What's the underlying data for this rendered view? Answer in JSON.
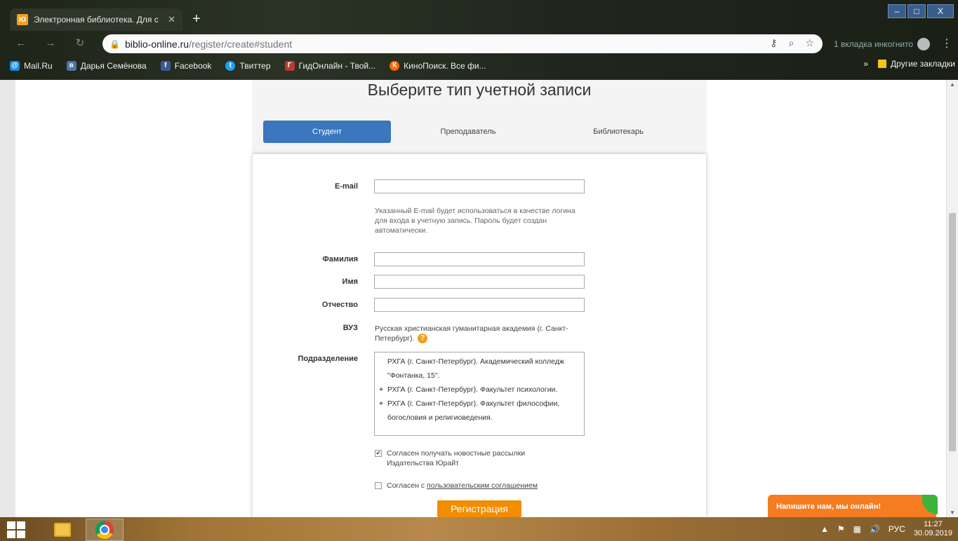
{
  "browser": {
    "tab_title": "Электронная библиотека. Для с",
    "tab_close": "✕",
    "new_tab": "+",
    "url_host": "biblio-online.ru",
    "url_path": "/register/create#student",
    "incognito_text": "1 вкладка инкогнито",
    "window_controls": {
      "minimize": "–",
      "maximize": "□",
      "close": "X"
    },
    "bookmarks": [
      {
        "label": "Mail.Ru",
        "icon": "mailru-icon",
        "color": "#168de2"
      },
      {
        "label": "Дарья Семёнова",
        "icon": "vk-icon",
        "color": "#4a76a8"
      },
      {
        "label": "Facebook",
        "icon": "facebook-icon",
        "color": "#3b5998"
      },
      {
        "label": "Твиттер",
        "icon": "twitter-icon",
        "color": "#1da1f2"
      },
      {
        "label": "ГидОнлайн - Твой...",
        "icon": "gidonline-icon",
        "color": "#c0392b"
      },
      {
        "label": "КиноПоиск. Все фи...",
        "icon": "kinopoisk-icon",
        "color": "#f60"
      }
    ],
    "bookmarks_overflow": "»",
    "other_bookmarks": "Другие закладки"
  },
  "page": {
    "title": "Выберите тип учетной записи",
    "account_types": [
      "Студент",
      "Преподаватель",
      "Библиотекарь"
    ],
    "active_type_index": 0,
    "form": {
      "email_label": "E-mail",
      "email_value": "",
      "email_hint": "Указанный E-mail будет использоваться в качестве логина для входа в учетную запись. Пароль будет создан автоматически.",
      "lastname_label": "Фамилия",
      "firstname_label": "Имя",
      "middlename_label": "Отчество",
      "vuz_label": "ВУЗ",
      "vuz_value": "Русская христианская гуманитарная академия (г. Санкт-Петербург).",
      "help_icon": "?",
      "division_label": "Подразделение",
      "divisions": [
        {
          "plus": "",
          "text": "РХГА (г. Санкт-Петербург). Академический колледж \"Фонтанка, 15\"."
        },
        {
          "plus": "+",
          "text": "РХГА (г. Санкт-Петербург). Факультет психологии."
        },
        {
          "plus": "+",
          "text": "РХГА (г. Санкт-Петербург). Факультет философии, богословия и религиоведения."
        }
      ],
      "newsletter_label": "Согласен получать новостные рассылки Издательства Юрайт",
      "newsletter_checked": true,
      "agreement_prefix": "Согласен с ",
      "agreement_link": "пользовательским соглашением",
      "agreement_checked": false,
      "register_button": "Регистрация"
    },
    "chat_widget": "Напишите нам, мы онлайн!"
  },
  "taskbar": {
    "language": "РУС",
    "time": "11:27",
    "date": "30.09.2019"
  },
  "colors": {
    "accent_blue": "#3a77bd",
    "accent_orange": "#f28c00"
  }
}
